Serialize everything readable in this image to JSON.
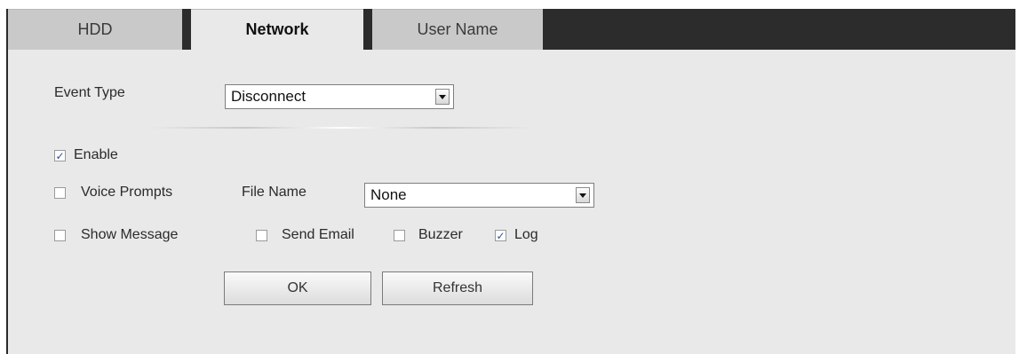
{
  "tabs": [
    {
      "label": "HDD",
      "active": false
    },
    {
      "label": "Network",
      "active": true
    },
    {
      "label": "User Name",
      "active": false
    }
  ],
  "event_type": {
    "label": "Event Type",
    "value": "Disconnect"
  },
  "enable": {
    "label": "Enable",
    "checked": true
  },
  "voice_prompts": {
    "label": "Voice Prompts",
    "checked": false
  },
  "file_name": {
    "label": "File Name",
    "value": "None"
  },
  "show_message": {
    "label": "Show Message",
    "checked": false
  },
  "send_email": {
    "label": "Send Email",
    "checked": false
  },
  "buzzer": {
    "label": "Buzzer",
    "checked": false
  },
  "log": {
    "label": "Log",
    "checked": true
  },
  "buttons": {
    "ok": "OK",
    "refresh": "Refresh"
  },
  "colors": {
    "tab_bar": "#2c2c2c",
    "panel": "#e9e9e9",
    "checkmark": "#2d4f9e"
  },
  "icons": {
    "dropdown": "chevron-down-icon",
    "check": "checkmark-icon"
  }
}
